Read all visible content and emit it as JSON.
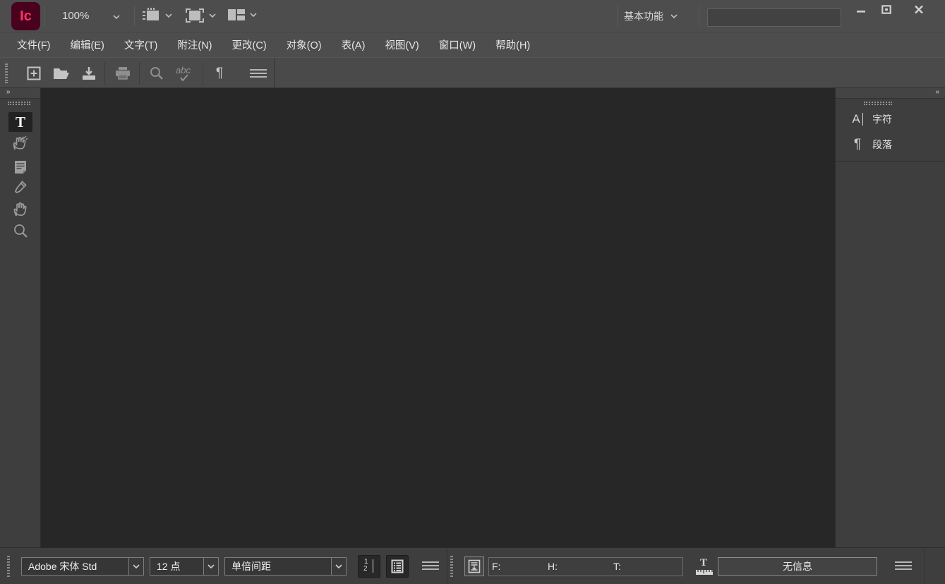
{
  "titlebar": {
    "logo_text": "Ic",
    "zoom_value": "100%",
    "workspace_label": "基本功能",
    "search_value": ""
  },
  "menubar": {
    "items": [
      "文件(F)",
      "编辑(E)",
      "文字(T)",
      "附注(N)",
      "更改(C)",
      "对象(O)",
      "表(A)",
      "视图(V)",
      "窗口(W)",
      "帮助(H)"
    ]
  },
  "icons": {
    "spellcheck_text": "abc",
    "pilcrow": "¶",
    "type_tool": "T",
    "char_panel": "A",
    "collapse_left": "»",
    "collapse_right": "«",
    "linenum_top": "1",
    "linenum_bottom": "2",
    "depth_letter": "T"
  },
  "right_panel": {
    "character_label": "字符",
    "paragraph_label": "段落"
  },
  "bottombar": {
    "font_family": "Adobe 宋体 Std",
    "font_size": "12 点",
    "leading": "单倍间距",
    "copyfit": {
      "f_label": "F:",
      "h_label": "H:",
      "t_label": "T:"
    },
    "info_status": "无信息"
  },
  "colors": {
    "logo_bg": "#49021e",
    "logo_fg": "#ff3366",
    "chrome": "#4d4d4d",
    "panel": "#3e3e3e",
    "canvas": "#272727"
  }
}
